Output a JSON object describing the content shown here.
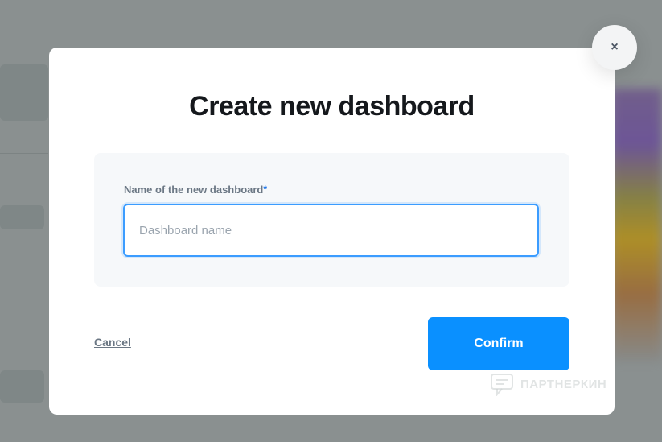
{
  "dialog": {
    "title": "Create new dashboard",
    "close_icon": "close-icon",
    "close_glyph": "×",
    "field": {
      "label": "Name of the new dashboard",
      "required_marker": "*",
      "value": "",
      "placeholder": "Dashboard name"
    },
    "cancel_label": "Cancel",
    "confirm_label": "Confirm"
  },
  "watermark": {
    "text": "ПАРТНЕРКИН",
    "icon": "chat-bubble-logo"
  },
  "colors": {
    "accent": "#0a90ff",
    "focus_border": "#3b9cff",
    "overlay": "#8a9090",
    "title_text": "#15181c",
    "label_text": "#6b7784"
  }
}
